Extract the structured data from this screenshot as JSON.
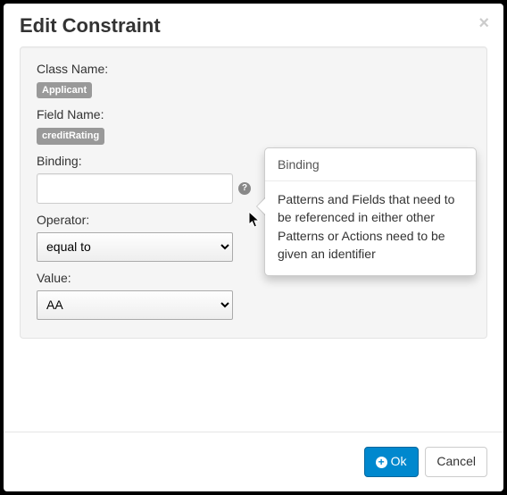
{
  "modal": {
    "title": "Edit Constraint",
    "close_glyph": "×"
  },
  "form": {
    "class_name_label": "Class Name:",
    "class_name_value": "Applicant",
    "field_name_label": "Field Name:",
    "field_name_value": "creditRating",
    "binding_label": "Binding:",
    "binding_value": "",
    "operator_label": "Operator:",
    "operator_value": "equal to",
    "value_label": "Value:",
    "value_value": "AA"
  },
  "popover": {
    "title": "Binding",
    "content": "Patterns and Fields that need to be referenced in either other Patterns or Actions need to be given an identifier"
  },
  "footer": {
    "ok_label": "Ok",
    "cancel_label": "Cancel"
  },
  "icons": {
    "help_glyph": "?",
    "plus_glyph": "+"
  }
}
